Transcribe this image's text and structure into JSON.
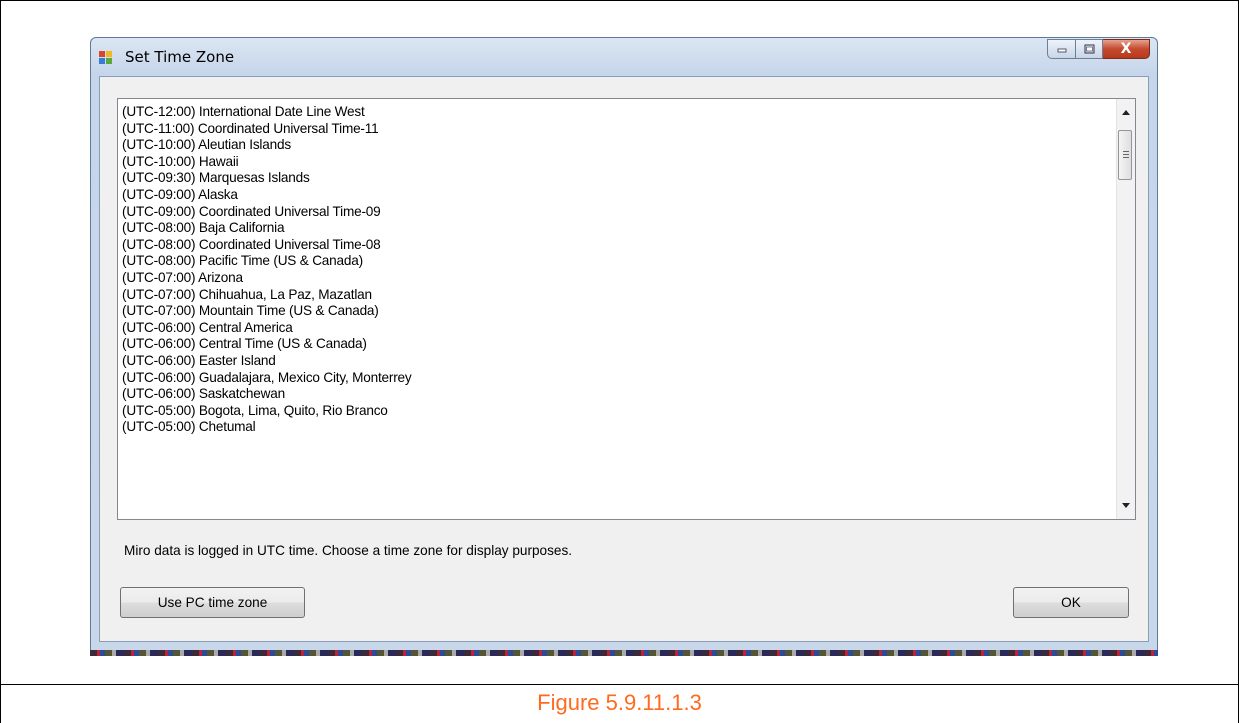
{
  "window": {
    "title": "Set Time Zone",
    "close_glyph": "X"
  },
  "timezones": [
    "(UTC-12:00) International Date Line West",
    "(UTC-11:00) Coordinated Universal Time-11",
    "(UTC-10:00) Aleutian Islands",
    "(UTC-10:00) Hawaii",
    "(UTC-09:30) Marquesas Islands",
    "(UTC-09:00) Alaska",
    "(UTC-09:00) Coordinated Universal Time-09",
    "(UTC-08:00) Baja California",
    "(UTC-08:00) Coordinated Universal Time-08",
    "(UTC-08:00) Pacific Time (US & Canada)",
    "(UTC-07:00) Arizona",
    "(UTC-07:00) Chihuahua, La Paz, Mazatlan",
    "(UTC-07:00) Mountain Time (US & Canada)",
    "(UTC-06:00) Central America",
    "(UTC-06:00) Central Time (US & Canada)",
    "(UTC-06:00) Easter Island",
    "(UTC-06:00) Guadalajara, Mexico City, Monterrey",
    "(UTC-06:00) Saskatchewan",
    "(UTC-05:00) Bogota, Lima, Quito, Rio Branco",
    "(UTC-05:00) Chetumal"
  ],
  "info_text": "Miro data is logged in UTC time. Choose a time zone for display purposes.",
  "buttons": {
    "use_pc": "Use PC time zone",
    "ok": "OK"
  },
  "caption": "Figure 5.9.11.1.3",
  "colors": {
    "caption": "#ff6a1f",
    "close_button": "#c44a2d"
  }
}
